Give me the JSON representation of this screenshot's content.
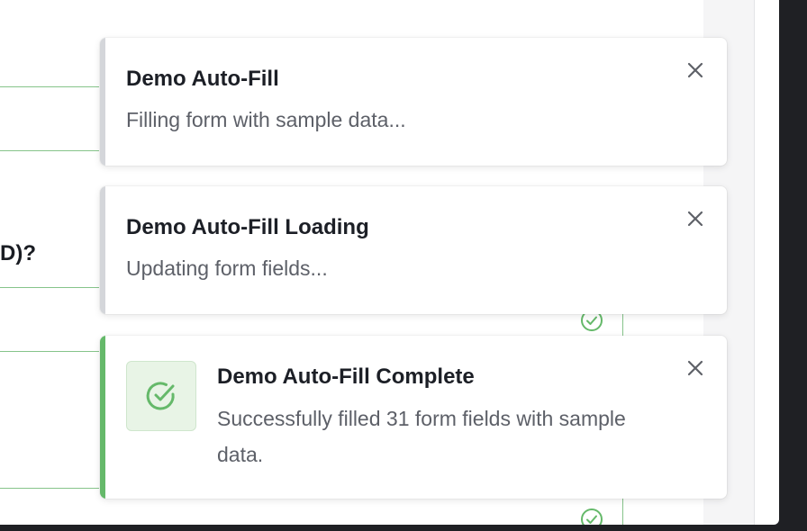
{
  "background_form": {
    "question_fragment": "D)?"
  },
  "toasts": [
    {
      "title": "Demo Auto-Fill",
      "message": "Filling form with sample data...",
      "type": "info"
    },
    {
      "title": "Demo Auto-Fill Loading",
      "message": "Updating form fields...",
      "type": "loading"
    },
    {
      "title": "Demo Auto-Fill Complete",
      "message": "Successfully filled 31 form fields with sample data.",
      "type": "success",
      "icon": "check-circle-icon"
    }
  ],
  "colors": {
    "success": "#65b96a",
    "neutral_accent": "#d4d6da",
    "form_line": "#86c48a"
  }
}
